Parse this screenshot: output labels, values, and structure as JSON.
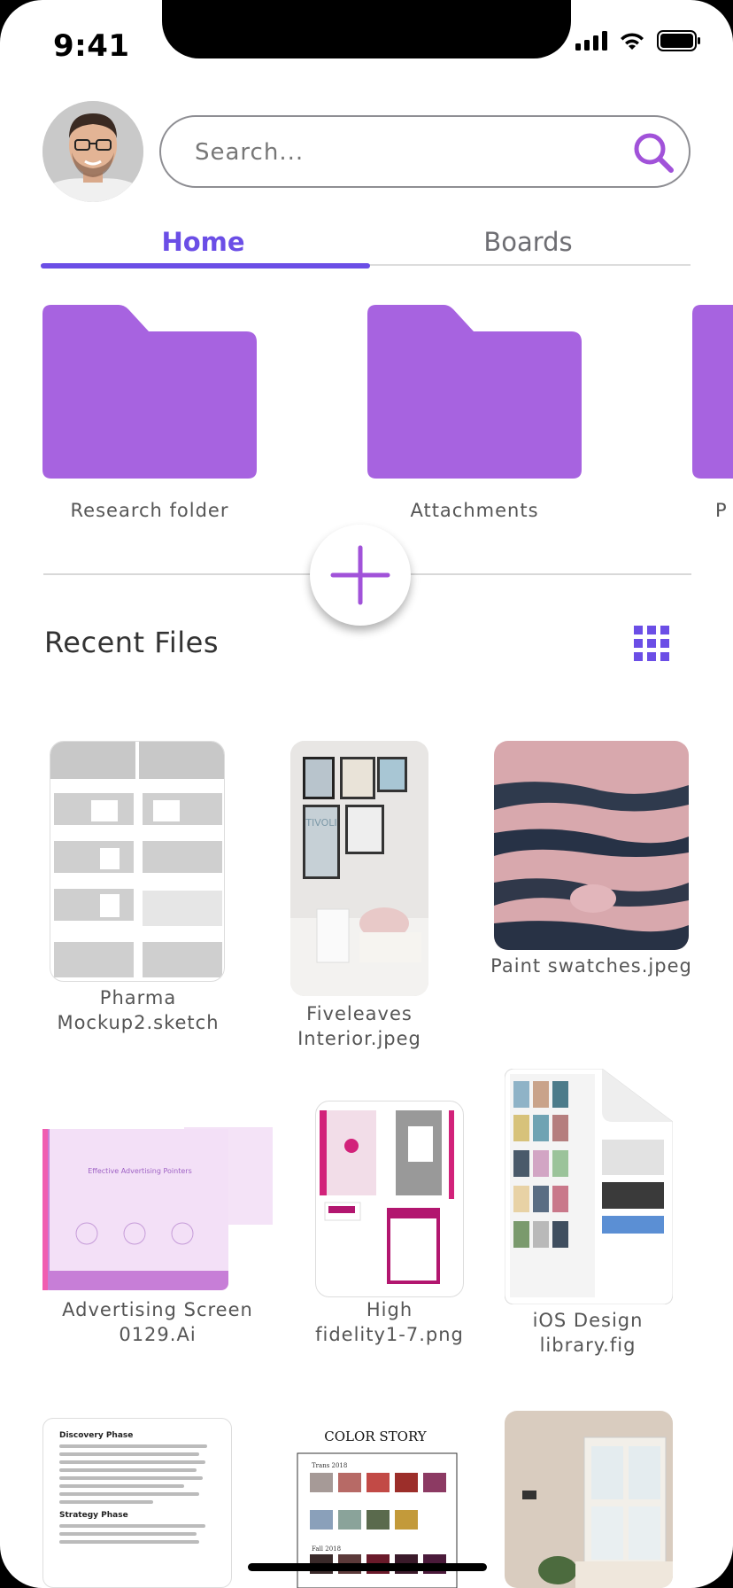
{
  "status_bar": {
    "time": "9:41"
  },
  "search": {
    "placeholder": "Search..."
  },
  "tabs": [
    {
      "label": "Home",
      "active": true
    },
    {
      "label": "Boards",
      "active": false
    }
  ],
  "folders": [
    {
      "label": "Research folder"
    },
    {
      "label": "Attachments"
    },
    {
      "label": "P"
    }
  ],
  "recent": {
    "title": "Recent Files",
    "view_icon": "grid-icon"
  },
  "files": [
    {
      "name": "Pharma Mockup2.sketch",
      "line1": "Pharma",
      "line2": "Mockup2.sketch"
    },
    {
      "name": "Fiveleaves Interior.jpeg",
      "line1": "Fiveleaves",
      "line2": "Interior.jpeg"
    },
    {
      "name": "Paint swatches.jpeg",
      "line1": "Paint swatches.jpeg",
      "line2": ""
    },
    {
      "name": "Advertising Screen 0129.Ai",
      "line1": "Advertising Screen",
      "line2": "0129.Ai"
    },
    {
      "name": "High fidelity1-7.png",
      "line1": "High",
      "line2": "fidelity1-7.png"
    },
    {
      "name": "iOS Design library.fig",
      "line1": "iOS Design",
      "line2": "library.fig"
    }
  ],
  "thumbnails": {
    "tivoli_text": "TIVOLI",
    "ad_heading": "Effective Advertising Pointers",
    "doc_phase1": "Discovery Phase",
    "doc_phase2": "Strategy Phase",
    "color_story_title": "COLOR STORY",
    "color_story_section1": "Trans 2018",
    "color_story_section2": "Fall 2018"
  },
  "colors": {
    "accent": "#6b4ee6",
    "folder": "#a763e0",
    "plus": "#a152d9"
  }
}
